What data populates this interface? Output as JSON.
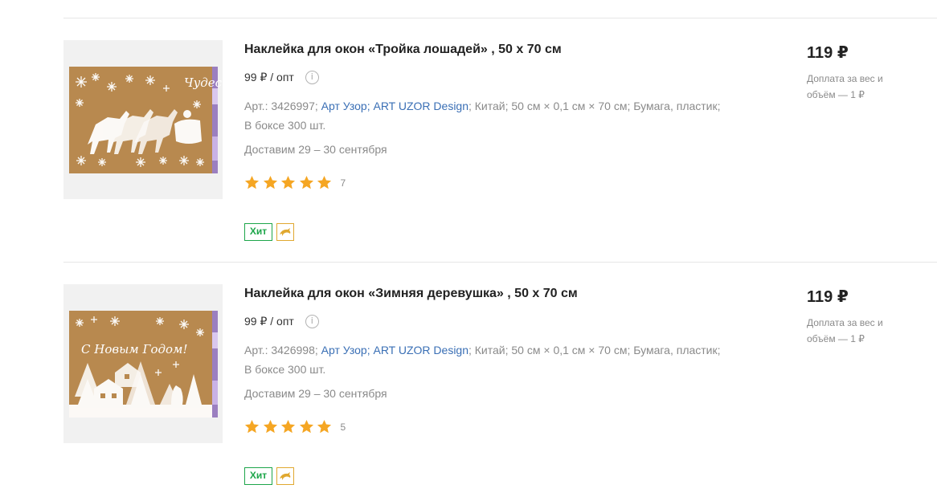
{
  "products": [
    {
      "title": "Наклейка для окон «Тройка лошадей» , 50 х 70 см",
      "opt_price": "99 ₽ / опт",
      "article": "Арт.: 3426997;",
      "brand": "Арт Узор;",
      "brand_sep": " ",
      "manufacturer": "ART UZOR Design",
      "spec_rest": "; Китай; 50 см × 0,1 см × 70 см; Бумага, пластик;",
      "box": "В боксе 300 шт.",
      "delivery": "Доставим 29 – 30 сентября",
      "rating": 5,
      "reviews": "7",
      "badge": "Хит",
      "price": "119 ₽",
      "surcharge": "Доплата за вес и объём — 1 ₽",
      "image_text": "Чудес"
    },
    {
      "title": "Наклейка для окон «Зимняя деревушка» , 50 х 70 см",
      "opt_price": "99 ₽ / опт",
      "article": "Арт.: 3426998;",
      "brand": "Арт Узор;",
      "brand_sep": " ",
      "manufacturer": "ART UZOR Design",
      "spec_rest": "; Китай; 50 см × 0,1 см × 70 см; Бумага, пластик;",
      "box": "В боксе 300 шт.",
      "delivery": "Доставим 29 – 30 сентября",
      "rating": 5,
      "reviews": "5",
      "badge": "Хит",
      "price": "119 ₽",
      "surcharge": "Доплата за вес и объём — 1 ₽",
      "image_text": "С Новым Годом!"
    }
  ],
  "colors": {
    "accent_link": "#3a6fb5",
    "star": "#f5a623",
    "hit_badge": "#1da64a",
    "kraft": "#b8894f"
  },
  "icons": {
    "info": "info-icon",
    "star": "star-icon",
    "dolphin": "dolphin-icon"
  }
}
